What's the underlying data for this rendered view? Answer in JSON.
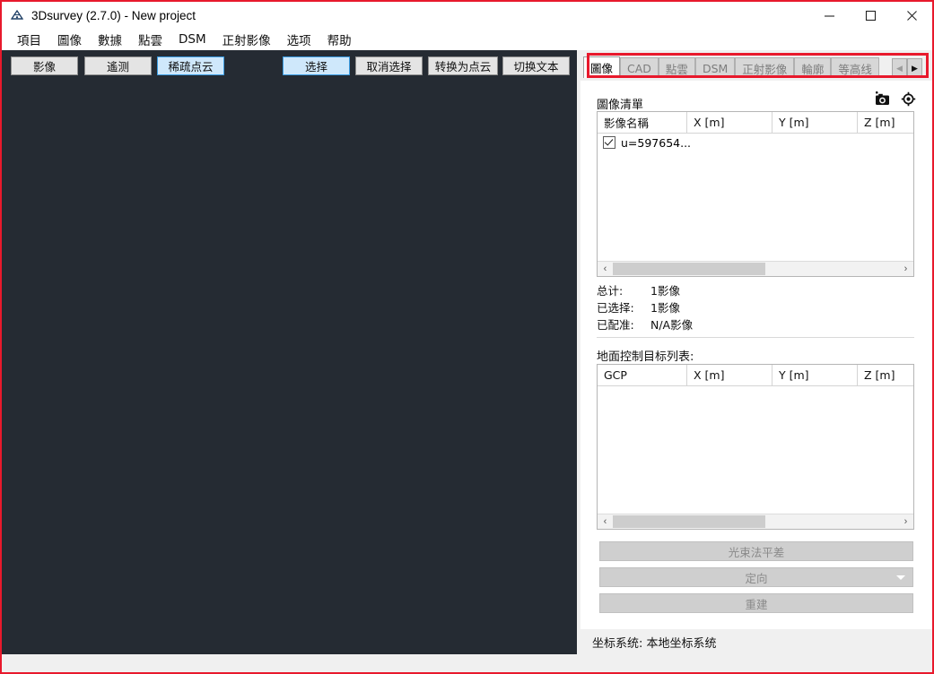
{
  "window": {
    "title": "3Dsurvey (2.7.0) - New project",
    "app_icon": "3dsurvey-logo-icon",
    "controls": {
      "minimize": "minimize-icon",
      "maximize": "maximize-icon",
      "close": "close-icon"
    }
  },
  "menubar": {
    "items": [
      {
        "label": "項目"
      },
      {
        "label": "圖像"
      },
      {
        "label": "數據"
      },
      {
        "label": "點雲"
      },
      {
        "label": "DSM"
      },
      {
        "label": "正射影像"
      },
      {
        "label": "选项"
      },
      {
        "label": "帮助"
      }
    ]
  },
  "toolbar": {
    "buttons": [
      {
        "label": "影像",
        "active": false
      },
      {
        "label": "遙测",
        "active": false
      },
      {
        "label": "稀疏点云",
        "active": true
      },
      {
        "label": "选择",
        "active": true
      },
      {
        "label": "取消选择",
        "active": false
      },
      {
        "label": "转换为点云",
        "active": false
      },
      {
        "label": "切换文本",
        "active": false
      }
    ]
  },
  "panel": {
    "tabs": [
      {
        "label": "圖像",
        "selected": true
      },
      {
        "label": "CAD",
        "selected": false
      },
      {
        "label": "點雲",
        "selected": false
      },
      {
        "label": "DSM",
        "selected": false
      },
      {
        "label": "正射影像",
        "selected": false
      },
      {
        "label": "輪廓",
        "selected": false
      },
      {
        "label": "等高线",
        "selected": false
      }
    ],
    "tab_scroll_left": "◀",
    "tab_scroll_right": "▶",
    "image_list": {
      "title": "圖像清單",
      "add_photo_icon": "add-camera-icon",
      "target_icon": "target-crosshair-icon",
      "columns": [
        "影像名稱",
        "X [m]",
        "Y [m]",
        "Z [m]"
      ],
      "rows": [
        {
          "name": "u=597654...",
          "checked": true,
          "x": "",
          "y": "",
          "z": ""
        }
      ],
      "scroll_left_icon": "‹",
      "scroll_right_icon": "›"
    },
    "stats": {
      "total_label": "总计:",
      "total_value": "1影像",
      "selected_label": "已选择:",
      "selected_value": "1影像",
      "registered_label": "已配准:",
      "registered_value": "N/A影像"
    },
    "gcp_list": {
      "title": "地面控制目标列表:",
      "columns": [
        "GCP",
        "X [m]",
        "Y [m]",
        "Z [m]"
      ],
      "rows": [],
      "scroll_left_icon": "‹",
      "scroll_right_icon": "›"
    },
    "actions": [
      {
        "label": "光束法平差",
        "disabled": true,
        "dropdown": false
      },
      {
        "label": "定向",
        "disabled": true,
        "dropdown": true
      },
      {
        "label": "重建",
        "disabled": true,
        "dropdown": false
      }
    ]
  },
  "statusbar": {
    "text": "坐标系统: 本地坐标系统"
  },
  "colors": {
    "accent_blue": "#cfe8fb",
    "accent_blue_border": "#3a9ce2",
    "viewport_dark": "#252b33",
    "annotation_red": "#e8192c",
    "panel_gray": "#f0f0f0"
  }
}
